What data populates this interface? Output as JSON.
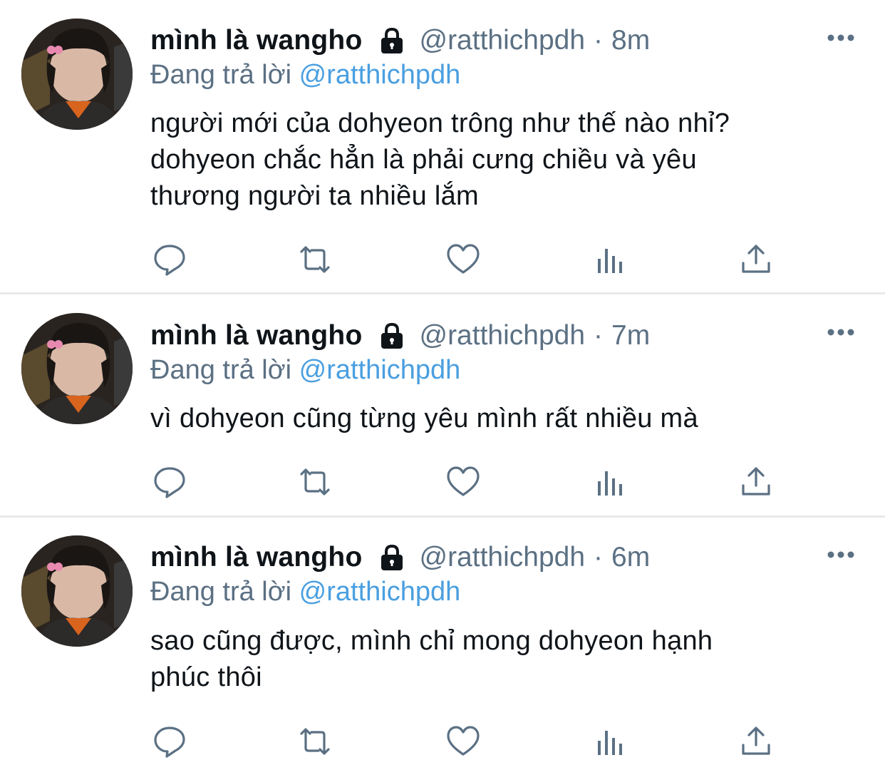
{
  "tweets": [
    {
      "display_name": "mình là wangho",
      "handle": "@ratthichpdh",
      "separator": "·",
      "time": "8m",
      "reply_prefix": "Đang trả lời",
      "reply_to": "@ratthichpdh",
      "text_lines": [
        "người mới của dohyeon trông như thế nào nhỉ?",
        "dohyeon chắc hẳn là phải cưng chiều và yêu",
        "thương người ta nhiều lắm"
      ],
      "locked": true
    },
    {
      "display_name": "mình là wangho",
      "handle": "@ratthichpdh",
      "separator": "·",
      "time": "7m",
      "reply_prefix": "Đang trả lời",
      "reply_to": "@ratthichpdh",
      "text_lines": [
        "vì dohyeon cũng từng yêu mình rất nhiều mà"
      ],
      "locked": true
    },
    {
      "display_name": "mình là wangho",
      "handle": "@ratthichpdh",
      "separator": "·",
      "time": "6m",
      "reply_prefix": "Đang trả lời",
      "reply_to": "@ratthichpdh",
      "text_lines": [
        "sao cũng được, mình chỉ mong dohyeon hạnh",
        "phúc thôi"
      ],
      "locked": true
    }
  ],
  "actions": [
    "reply-icon",
    "retweet-icon",
    "like-icon",
    "analytics-icon",
    "share-icon"
  ],
  "colors": {
    "text": "#0f1419",
    "secondary": "#5b7083",
    "mention": "#4a9fe0",
    "divider": "#e6e8ea"
  }
}
